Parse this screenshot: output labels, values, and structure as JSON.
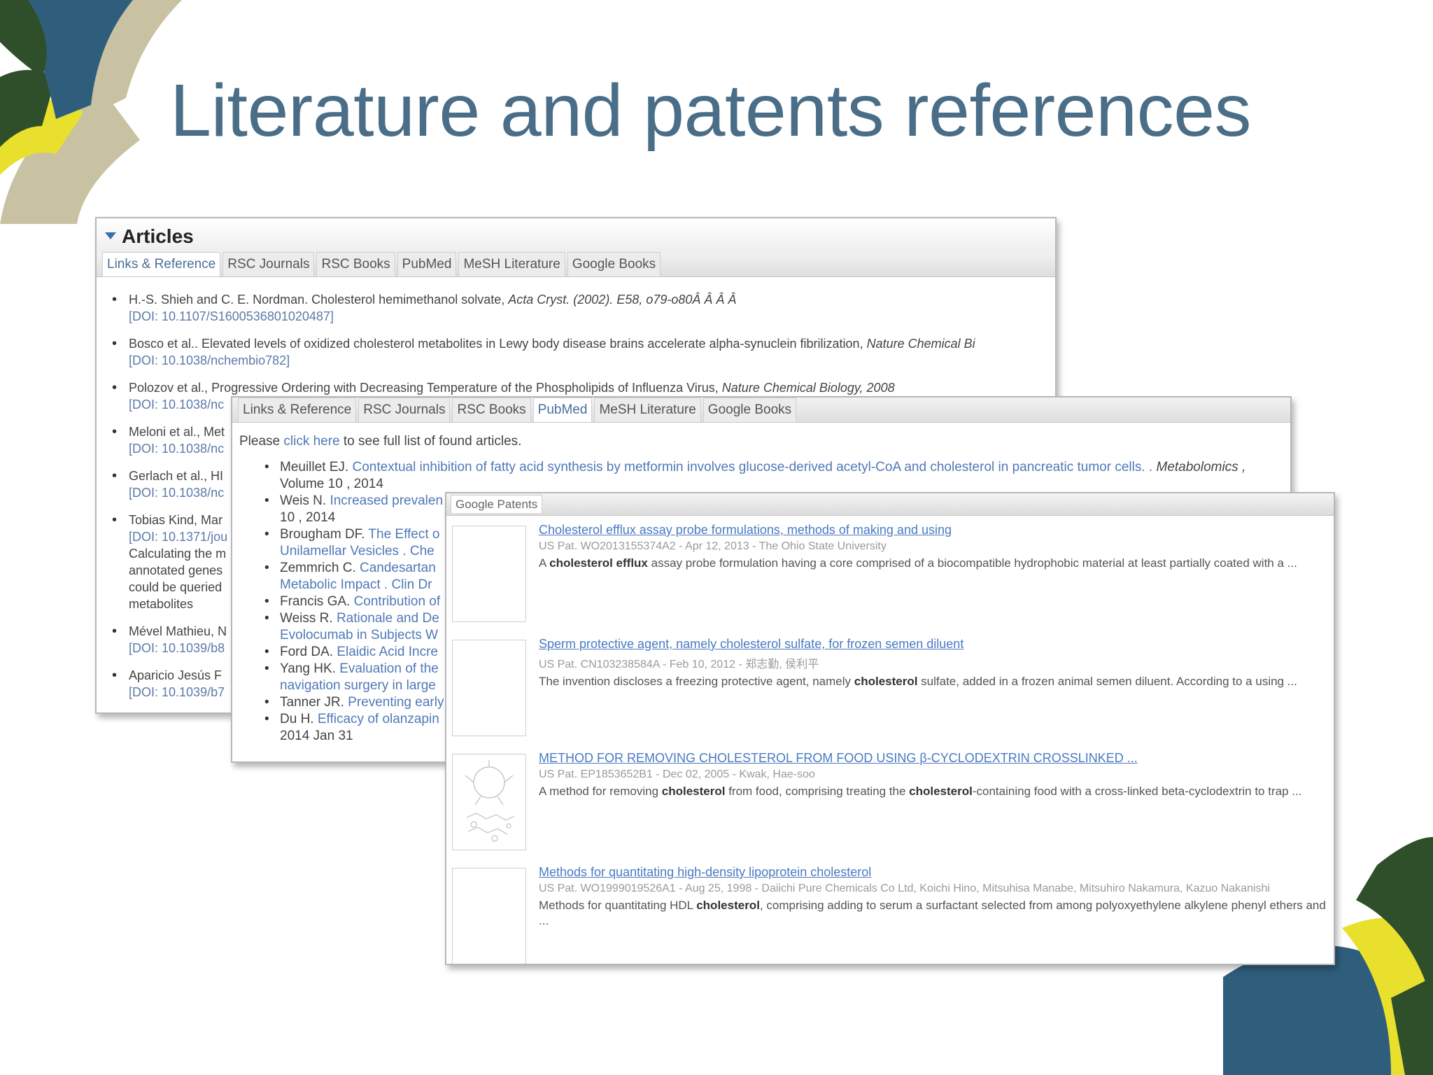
{
  "slide": {
    "title": "Literature and patents references"
  },
  "colors": {
    "title_blue": "#4a6e88",
    "deco_navy": "#2f5e7c",
    "deco_green": "#2f4f2a",
    "deco_yellow": "#e8e02c",
    "deco_tan": "#c9c2a2",
    "link_blue": "#4f79b7"
  },
  "articles_panel": {
    "header": "Articles",
    "tabs": [
      "Links & Reference",
      "RSC Journals",
      "RSC Books",
      "PubMed",
      "MeSH Literature",
      "Google Books"
    ],
    "refs": [
      {
        "text": "H.-S. Shieh and C. E. Nordman. Cholesterol hemimethanol solvate, ",
        "journal": "Acta Cryst. (2002). E58, o79-o80Â Â Â Â",
        "doi": "[DOI: 10.1107/S1600536801020487]"
      },
      {
        "text": "Bosco et al.. Elevated levels of oxidized cholesterol metabolites in Lewy body disease brains accelerate alpha-synuclein fibrilization, ",
        "journal": "Nature Chemical Bi",
        "doi": "[DOI: 10.1038/nchembio782]"
      },
      {
        "text": "Polozov et al., Progressive Ordering with Decreasing Temperature of the Phospholipids of Influenza Virus, ",
        "journal": "Nature Chemical Biology, 2008",
        "doi": "[DOI: 10.1038/nc"
      },
      {
        "text": "Meloni et al., Met",
        "journal": "",
        "doi": "[DOI: 10.1038/nc"
      },
      {
        "text": "Gerlach et al., HI",
        "journal": "",
        "doi": "[DOI: 10.1038/nc"
      },
      {
        "text": "Tobias Kind, Mar",
        "journal": "",
        "doi": "[DOI: 10.1371/jou",
        "extra": [
          "Calculating the m",
          "annotated genes",
          "could be queried",
          "metabolites"
        ]
      },
      {
        "text": "Mével Mathieu, N",
        "journal": "",
        "doi": "[DOI: 10.1039/b8"
      },
      {
        "text": "Aparicio Jesús F",
        "journal": "",
        "doi": "[DOI: 10.1039/b7"
      }
    ]
  },
  "pubmed_panel": {
    "tabs": [
      "Links & Reference",
      "RSC Journals",
      "RSC Books",
      "PubMed",
      "MeSH Literature",
      "Google Books"
    ],
    "notice_before": "Please ",
    "notice_link": "click here",
    "notice_after": " to see full list of found articles.",
    "items": [
      {
        "author": "Meuillet EJ. ",
        "title": "Contextual inhibition of fatty acid synthesis by metformin involves glucose-derived acetyl-CoA and cholesterol in pancreatic tumor cells. .",
        "journal": " Metabolomics ,",
        "cont": "Volume 10 , 2014"
      },
      {
        "author": "Weis N. ",
        "title": "Increased prevalen",
        "journal": "",
        "cont": "10 , 2014"
      },
      {
        "author": "Brougham DF. ",
        "title": "The Effect o",
        "journal": "",
        "cont": "Unilamellar Vesicles . Che"
      },
      {
        "author": "Zemmrich C. ",
        "title": "Candesartan",
        "journal": "",
        "cont": "Metabolic Impact . Clin Dr"
      },
      {
        "author": "Francis GA. ",
        "title": "Contribution of",
        "journal": "",
        "cont": ""
      },
      {
        "author": "Weiss R. ",
        "title": "Rationale and De",
        "journal": "",
        "cont": "Evolocumab in Subjects W"
      },
      {
        "author": "Ford DA. ",
        "title": "Elaidic Acid Incre",
        "journal": "",
        "cont": ""
      },
      {
        "author": "Yang HK. ",
        "title": "Evaluation of the",
        "journal": "",
        "cont": "navigation surgery in large"
      },
      {
        "author": "Tanner JR. ",
        "title": "Preventing early",
        "journal": "",
        "cont": ""
      },
      {
        "author": "Du H. ",
        "title": "Efficacy of olanzapin",
        "journal": "",
        "cont": "2014 Jan 31"
      }
    ]
  },
  "patents_panel": {
    "header": "Google Patents",
    "patents": [
      {
        "title": "Cholesterol efflux assay probe formulations, methods of making and using",
        "meta": "US Pat. WO2013155374A2 - Apr 12, 2013 - The Ohio State University",
        "snippet_before": "A ",
        "bold1": "cholesterol efflux",
        "snippet_mid": " assay probe formulation having a core comprised of a biocompatible hydrophobic material at least partially coated with a ...",
        "bold2": "",
        "snippet_after": ""
      },
      {
        "title": "Sperm protective agent, namely cholesterol sulfate, for frozen semen diluent",
        "meta": "US Pat. CN103238584A - Feb 10, 2012 - 郑志勤, 侯利平",
        "snippet_before": "The invention discloses a freezing protective agent, namely ",
        "bold1": "cholesterol",
        "snippet_mid": " sulfate, added in a frozen animal semen diluent. According to a using ...",
        "bold2": "",
        "snippet_after": ""
      },
      {
        "title": "METHOD FOR REMOVING CHOLESTEROL FROM FOOD USING β-CYCLODEXTRIN CROSSLINKED ...",
        "meta": "US Pat. EP1853652B1 - Dec 02, 2005 - Kwak, Hae-soo",
        "snippet_before": "A method for removing ",
        "bold1": "cholesterol",
        "snippet_mid": " from food, comprising treating the ",
        "bold2": "cholesterol",
        "snippet_after": "-containing food with a cross-linked beta-cyclodextrin to trap ..."
      },
      {
        "title": "Methods for quantitating high-density lipoprotein cholesterol",
        "meta": "US Pat. WO1999019526A1 - Aug 25, 1998 - Daiichi Pure Chemicals Co Ltd, Koichi Hino, Mitsuhisa Manabe, Mitsuhiro Nakamura, Kazuo Nakanishi",
        "snippet_before": "Methods for quantitating HDL ",
        "bold1": "cholesterol",
        "snippet_mid": ", comprising adding to serum a surfactant selected from among polyoxyethylene alkylene phenyl ethers and ...",
        "bold2": "",
        "snippet_after": ""
      }
    ]
  }
}
